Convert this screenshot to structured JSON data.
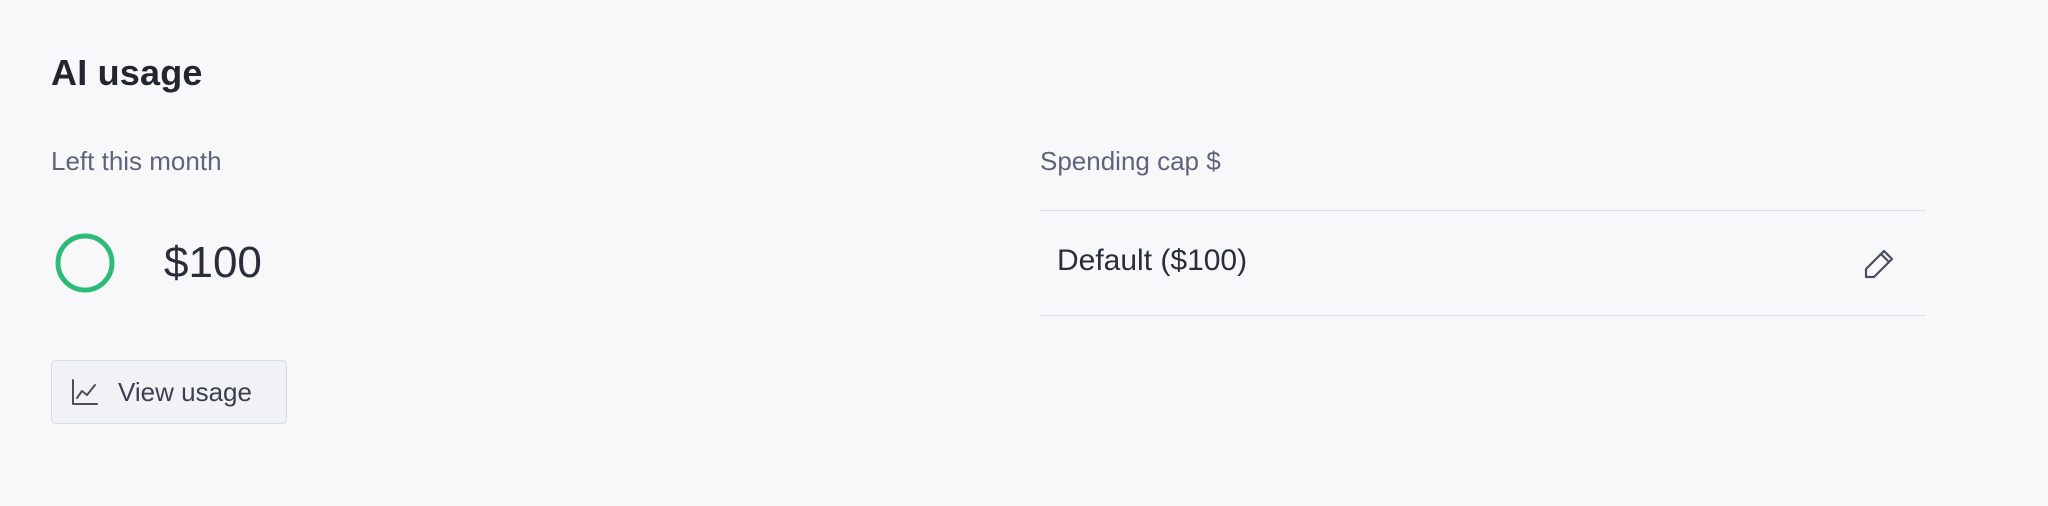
{
  "section": {
    "title": "AI usage"
  },
  "remaining": {
    "label": "Left this month",
    "value": "$100",
    "ring_icon": "remaining-ring-icon",
    "ring_color": "#2dbb78"
  },
  "view_usage_button": {
    "label": "View usage",
    "icon": "line-chart-icon"
  },
  "spending_cap": {
    "label": "Spending cap $",
    "value": "Default ($100)",
    "edit_icon": "pencil-icon"
  }
}
